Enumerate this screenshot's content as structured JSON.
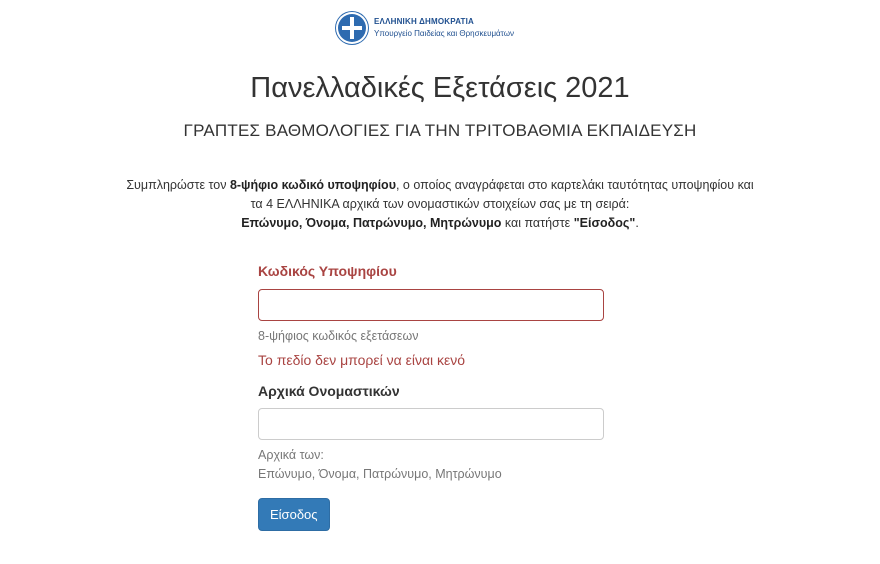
{
  "header": {
    "emblem": "greek-republic-emblem",
    "line1": "ΕΛΛΗΝΙΚΗ ΔΗΜΟΚΡΑΤΙΑ",
    "line2": "Υπουργείο Παιδείας και Θρησκευμάτων"
  },
  "page": {
    "title": "Πανελλαδικές Εξετάσεις 2021",
    "subtitle": "ΓΡΑΠΤΕΣ ΒΑΘΜΟΛΟΓΙΕΣ ΓΙΑ ΤΗΝ ΤΡΙΤΟΒΑΘΜΙΑ ΕΚΠΑΙΔΕΥΣΗ"
  },
  "instructions": {
    "part1": "Συμπληρώστε τον ",
    "bold1": "8-ψήφιο κωδικό υποψηφίου",
    "part2": ", ο οποίος αναγράφεται στο καρτελάκι ταυτότητας υποψηφίου και τα 4 ΕΛΛΗΝΙΚΑ αρχικά των ονομαστικών στοιχείων σας με τη σειρά:",
    "bold2": "Επώνυμο, Όνομα, Πατρώνυμο, Μητρώνυμο",
    "part3": " και πατήστε ",
    "bold3": "\"Είσοδος\"",
    "part4": "."
  },
  "form": {
    "code": {
      "label": "Κωδικός Υποψηφίου",
      "value": "",
      "help": "8-ψήφιος κωδικός εξετάσεων",
      "error": "Το πεδίο δεν μπορεί να είναι κενό",
      "error_color": "#a94442"
    },
    "initials": {
      "label": "Αρχικά Ονομαστικών",
      "value": "",
      "help_line1": "Αρχικά των:",
      "help_line2": "Επώνυμο, Όνομα, Πατρώνυμο, Μητρώνυμο"
    },
    "submit_label": "Είσοδος",
    "button_color": "#337ab7"
  }
}
